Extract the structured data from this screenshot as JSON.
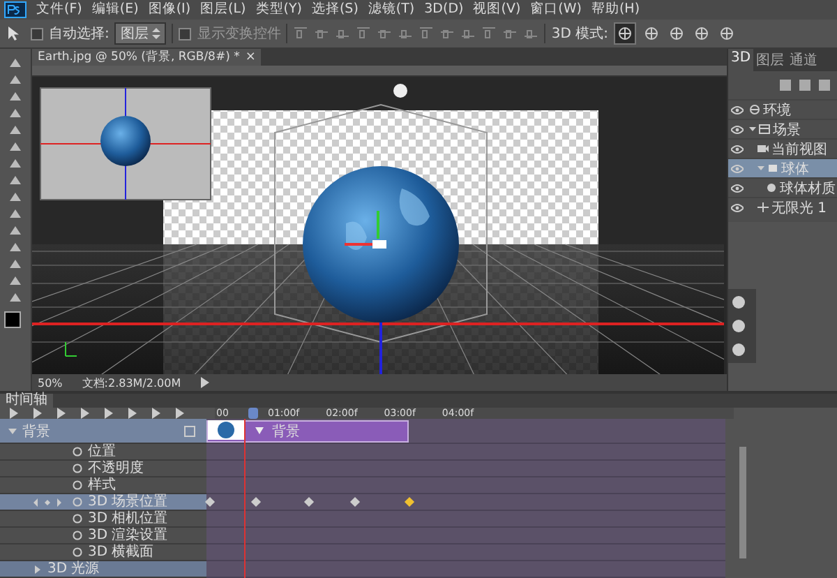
{
  "menu": [
    "文件(F)",
    "编辑(E)",
    "图像(I)",
    "图层(L)",
    "类型(Y)",
    "选择(S)",
    "滤镜(T)",
    "3D(D)",
    "视图(V)",
    "窗口(W)",
    "帮助(H)"
  ],
  "options_bar": {
    "auto_select": {
      "label": "自动选择:",
      "checked": false
    },
    "target": "图层",
    "show_transform": {
      "label": "显示变换控件",
      "checked": false
    },
    "mode_label": "3D 模式:"
  },
  "document": {
    "tab_title": "Earth.jpg @ 50% (背景, RGB/8#) *",
    "close": "×",
    "zoom": "50%",
    "doc_info": "文档:2.83M/2.00M"
  },
  "panel_3d": {
    "tabs": [
      {
        "label": "3D",
        "selected": true
      },
      {
        "label": "图层",
        "selected": false
      },
      {
        "label": "通道",
        "selected": false
      }
    ],
    "items": [
      {
        "label": "环境",
        "kind": "environment",
        "selected": false
      },
      {
        "label": "场景",
        "kind": "scene",
        "selected": false,
        "expanded": true,
        "children": [
          {
            "label": "当前视图",
            "kind": "camera",
            "selected": false
          },
          {
            "label": "球体",
            "kind": "mesh",
            "selected": true,
            "expanded": true,
            "children": [
              {
                "label": "球体材质",
                "kind": "material",
                "selected": false
              }
            ]
          },
          {
            "label": "无限光 1",
            "kind": "light",
            "selected": false
          }
        ]
      }
    ]
  },
  "timeline": {
    "title": "时间轴",
    "ruler": [
      "00",
      "01:00f",
      "02:00f",
      "03:00f",
      "04:00f"
    ],
    "playhead": {
      "level": 0.065
    },
    "layer": {
      "name": "背景",
      "expanded": true,
      "clip_label": "背景",
      "clip": {
        "level": 0.39
      }
    },
    "properties": [
      {
        "label": "位置",
        "selected": false
      },
      {
        "label": "不透明度",
        "selected": false
      },
      {
        "label": "样式",
        "selected": false
      },
      {
        "label": "3D 场景位置",
        "selected": true,
        "keyframes": [
          {
            "level": 0.0,
            "selected": false
          },
          {
            "level": 0.09,
            "selected": false
          },
          {
            "level": 0.19,
            "selected": false
          },
          {
            "level": 0.28,
            "selected": false
          },
          {
            "level": 0.385,
            "selected": true
          }
        ]
      },
      {
        "label": "3D 相机位置",
        "selected": false
      },
      {
        "label": "3D 渲染设置",
        "selected": false
      },
      {
        "label": "3D 横截面",
        "selected": false
      }
    ],
    "groups": [
      {
        "label": "3D 光源",
        "expanded": false
      }
    ]
  }
}
